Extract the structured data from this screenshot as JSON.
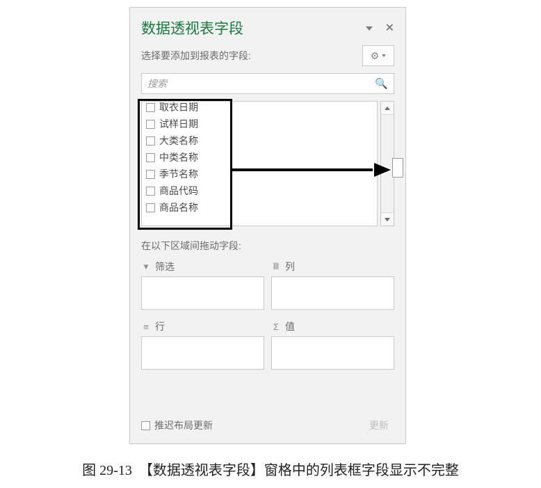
{
  "panel": {
    "title": "数据透视表字段",
    "subtitle": "选择要添加到报表的字段:",
    "search_placeholder": "搜索"
  },
  "fields": [
    "取衣日期",
    "试样日期",
    "大类名称",
    "中类名称",
    "季节名称",
    "商品代码",
    "商品名称"
  ],
  "drag_label": "在以下区域间拖动字段:",
  "zones": {
    "filter": "筛选",
    "columns": "列",
    "rows": "行",
    "values": "值"
  },
  "footer": {
    "defer": "推迟布局更新",
    "update": "更新"
  },
  "caption": "图 29-13　【数据透视表字段】窗格中的列表框字段显示不完整"
}
